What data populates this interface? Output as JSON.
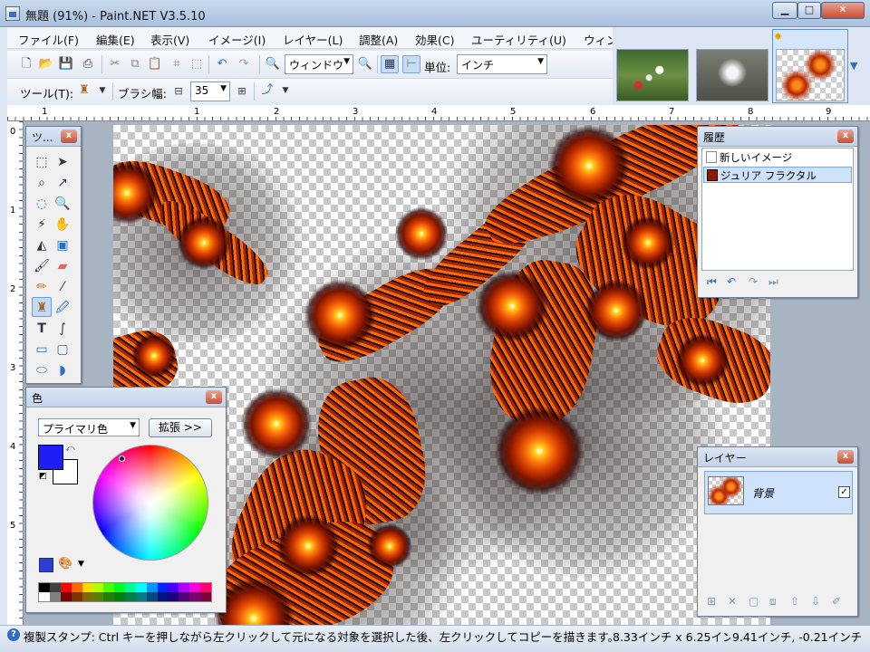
{
  "window": {
    "title": "無題 (91%) - Paint.NET V3.5.10"
  },
  "menu": [
    "ファイル(F)",
    "編集(E)",
    "表示(V)",
    "イメージ(I)",
    "レイヤー(L)",
    "調整(A)",
    "効果(C)",
    "ユーティリティ(U)",
    "ウィン"
  ],
  "toolbar": {
    "zoom_value": "ウィンドウ",
    "units_label": "単位:",
    "units_value": "インチ",
    "tool_label": "ツール(T):",
    "brush_label": "ブラシ幅:",
    "brush_width": "35"
  },
  "rulers": {
    "h": [
      "1",
      "1",
      "2",
      "3",
      "4",
      "5",
      "6",
      "7",
      "8",
      "9"
    ],
    "v": [
      "0",
      "1",
      "2",
      "3",
      "4",
      "5"
    ]
  },
  "panels": {
    "tools": {
      "title": "ツ..."
    },
    "colors": {
      "title": "色",
      "mode": "プライマリ色",
      "expand": "拡張 >>",
      "primary_color": "#1e1ef5",
      "secondary_color": "#ffffff"
    },
    "history": {
      "title": "履歴",
      "items": [
        "新しいイメージ",
        "ジュリア フラクタル"
      ]
    },
    "layers": {
      "title": "レイヤー",
      "layer_name": "背景"
    }
  },
  "status": {
    "help": "複製スタンプ: Ctrl キーを押しながら左クリックして元になる対象を選択した後、左クリックしてコピーを描きます。",
    "size": "8.33インチ x 6.25インチ",
    "position": "9.41インチ, -0.21インチ"
  },
  "icons": [
    "new-icon",
    "open-icon",
    "save-icon",
    "print-icon",
    "cut-icon",
    "copy-icon",
    "paste-icon",
    "crop-icon",
    "deselect-icon",
    "undo-icon",
    "redo-icon",
    "zoom-out-icon",
    "zoom-in-icon",
    "grid-icon",
    "ruler-icon",
    "clone-stamp-icon",
    "antialias-icon"
  ]
}
